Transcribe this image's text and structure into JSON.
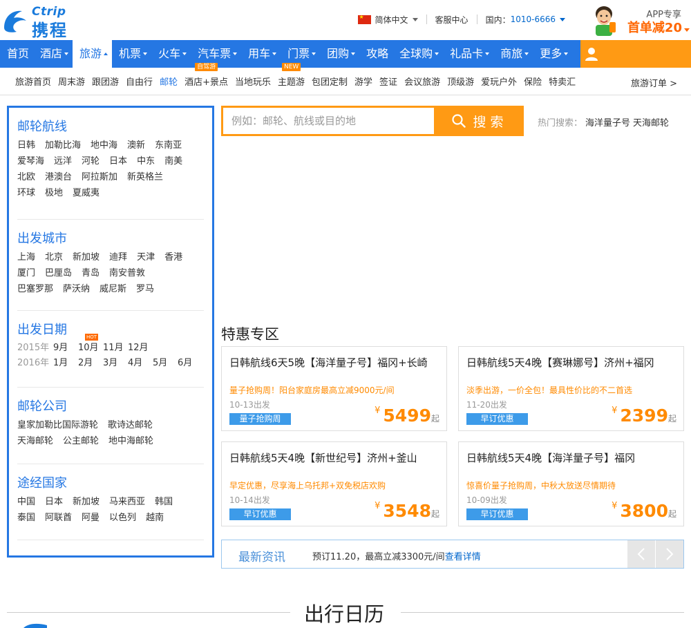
{
  "colors": {
    "brand_blue": "#2577e3",
    "accent_orange": "#ff9a14",
    "price_orange": "#ff8a00",
    "tag_blue": "#3d9be9"
  },
  "header": {
    "logo_en": "Ctrip",
    "logo_cn": "携程",
    "language": "简体中文",
    "service": "客服中心",
    "phone_label": "国内：",
    "phone": "1010-6666",
    "app_label": "APP专享",
    "app_offer": "首单减20"
  },
  "nav": {
    "items": [
      {
        "label": "首页",
        "dropdown": false
      },
      {
        "label": "酒店",
        "dropdown": true
      },
      {
        "label": "旅游",
        "dropdown": true,
        "active": true
      },
      {
        "label": "机票",
        "dropdown": true
      },
      {
        "label": "火车",
        "dropdown": true
      },
      {
        "label": "汽车票",
        "dropdown": true
      },
      {
        "label": "用车",
        "dropdown": true
      },
      {
        "label": "门票",
        "dropdown": true
      },
      {
        "label": "团购",
        "dropdown": true
      },
      {
        "label": "攻略",
        "dropdown": false
      },
      {
        "label": "全球购",
        "dropdown": true
      },
      {
        "label": "礼品卡",
        "dropdown": true
      },
      {
        "label": "商旅",
        "dropdown": true
      },
      {
        "label": "更多",
        "dropdown": true
      }
    ],
    "user_icon": "user-icon"
  },
  "subnav": {
    "items": [
      {
        "label": "旅游首页"
      },
      {
        "label": "周末游"
      },
      {
        "label": "跟团游"
      },
      {
        "label": "自由行"
      },
      {
        "label": "邮轮",
        "active": true
      },
      {
        "label": "酒店+景点",
        "badge": "自驾游"
      },
      {
        "label": "当地玩乐"
      },
      {
        "label": "主题游",
        "badge": "NEW"
      },
      {
        "label": "包团定制"
      },
      {
        "label": "游学"
      },
      {
        "label": "签证"
      },
      {
        "label": "会议旅游"
      },
      {
        "label": "顶级游"
      },
      {
        "label": "爱玩户外"
      },
      {
        "label": "保险"
      },
      {
        "label": "特卖汇"
      }
    ],
    "orders": "旅游订单 >"
  },
  "left": {
    "routes": {
      "title": "邮轮航线",
      "items": [
        "日韩",
        "加勒比海",
        "地中海",
        "澳新",
        "东南亚",
        "爱琴海",
        "远洋",
        "河轮",
        "日本",
        "中东",
        "南美",
        "北欧",
        "港澳台",
        "阿拉斯加",
        "新英格兰",
        "环球",
        "极地",
        "夏威夷"
      ]
    },
    "cities": {
      "title": "出发城市",
      "items": [
        "上海",
        "北京",
        "新加坡",
        "迪拜",
        "天津",
        "香港",
        "厦门",
        "巴厘岛",
        "青岛",
        "南安普敦",
        "巴塞罗那",
        "萨沃纳",
        "威尼斯",
        "罗马"
      ]
    },
    "dates": {
      "title": "出发日期",
      "rows": [
        {
          "year": "2015年",
          "months": [
            "9月",
            "10月",
            "11月",
            "12月"
          ],
          "hot_month_index": 1
        },
        {
          "year": "2016年",
          "months": [
            "1月",
            "2月",
            "3月",
            "4月",
            "5月",
            "6月"
          ]
        }
      ],
      "hot_label": "HOT"
    },
    "companies": {
      "title": "邮轮公司",
      "items": [
        "皇家加勒比国际游轮",
        "歌诗达邮轮",
        "天海邮轮",
        "公主邮轮",
        "地中海邮轮"
      ]
    },
    "countries": {
      "title": "途经国家",
      "items": [
        "中国",
        "日本",
        "新加坡",
        "马来西亚",
        "韩国",
        "泰国",
        "阿联酋",
        "阿曼",
        "以色列",
        "越南"
      ]
    }
  },
  "search": {
    "placeholder": "例如：邮轮、航线或目的地",
    "button": "搜 索",
    "hot_label": "热门搜索：",
    "hot_terms": [
      "海洋量子号",
      "天海邮轮"
    ]
  },
  "deals": {
    "title": "特惠专区",
    "items": [
      {
        "name": "日韩航线6天5晚【海洋量子号】福冈+长崎",
        "promo": "量子抢购周！阳台家庭房最高立减9000元/间",
        "date": "10-13出发",
        "tag": "量子抢购周",
        "currency": "¥",
        "price": "5499",
        "suffix": "起"
      },
      {
        "name": "日韩航线5天4晚【赛琳娜号】济州+福冈",
        "promo": "淡季出游，一价全包！最具性价比的不二首选",
        "date": "11-20出发",
        "tag": "早订优惠",
        "currency": "¥",
        "price": "2399",
        "suffix": "起"
      },
      {
        "name": "日韩航线5天4晚【新世纪号】济州+釜山",
        "promo": "早定优惠，尽享海上乌托邦+双免税店欢购",
        "date": "10-14出发",
        "tag": "早订优惠",
        "currency": "¥",
        "price": "3548",
        "suffix": "起"
      },
      {
        "name": "日韩航线5天4晚【海洋量子号】福冈",
        "promo": "惊喜价量子抢购周，中秋大放送尽情期待",
        "date": "10-09出发",
        "tag": "早订优惠",
        "currency": "¥",
        "price": "3800",
        "suffix": "起"
      }
    ]
  },
  "news": {
    "title": "最新资讯",
    "text": "预订11.20，最高立减3300元/间",
    "link": "查看详情"
  },
  "calendar": {
    "title": "出行日历"
  }
}
